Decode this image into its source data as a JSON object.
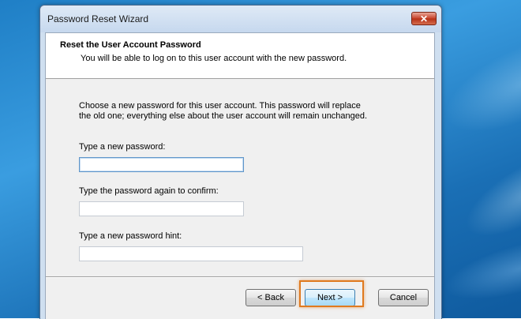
{
  "window": {
    "title": "Password Reset Wizard",
    "close_glyph": "✕"
  },
  "header": {
    "title": "Reset the User Account Password",
    "subtitle": "You will be able to log on to this user account with the new password."
  },
  "body": {
    "description_line1": "Choose a new password for this user account. This password will replace",
    "description_line2": "the old one; everything else about the user account will remain unchanged.",
    "new_password_label": "Type a new password:",
    "new_password_value": "",
    "confirm_password_label": "Type the password again to confirm:",
    "confirm_password_value": "",
    "hint_label": "Type a new password hint:",
    "hint_value": ""
  },
  "buttons": {
    "back": "< Back",
    "next": "Next >",
    "cancel": "Cancel"
  },
  "colors": {
    "highlight": "#e07a1f",
    "close": "#c7422a"
  },
  "icons": [
    "close-icon"
  ]
}
